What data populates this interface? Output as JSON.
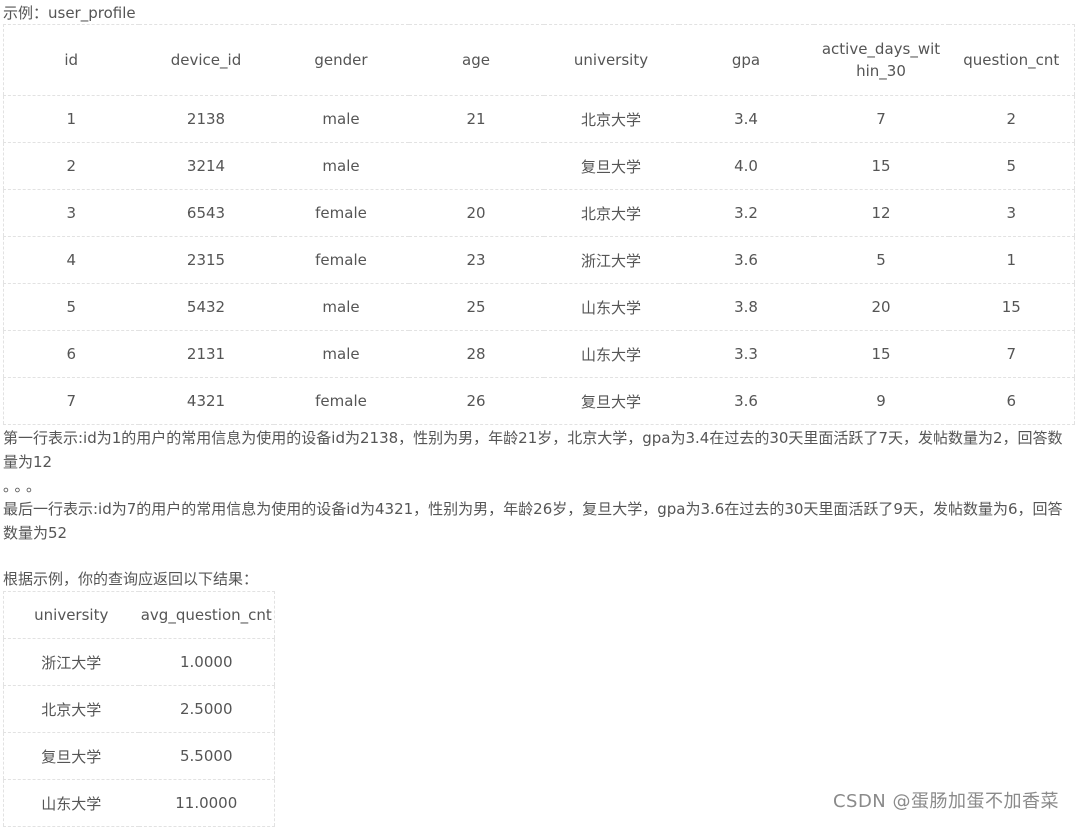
{
  "caption": "示例：user_profile",
  "table1": {
    "headers": [
      "id",
      "device_id",
      "gender",
      "age",
      "university",
      "gpa",
      "active_days_within_30",
      "question_cnt"
    ],
    "rows": [
      [
        "1",
        "2138",
        "male",
        "21",
        "北京大学",
        "3.4",
        "7",
        "2"
      ],
      [
        "2",
        "3214",
        "male",
        "",
        "复旦大学",
        "4.0",
        "15",
        "5"
      ],
      [
        "3",
        "6543",
        "female",
        "20",
        "北京大学",
        "3.2",
        "12",
        "3"
      ],
      [
        "4",
        "2315",
        "female",
        "23",
        "浙江大学",
        "3.6",
        "5",
        "1"
      ],
      [
        "5",
        "5432",
        "male",
        "25",
        "山东大学",
        "3.8",
        "20",
        "15"
      ],
      [
        "6",
        "2131",
        "male",
        "28",
        "山东大学",
        "3.3",
        "15",
        "7"
      ],
      [
        "7",
        "4321",
        "female",
        "26",
        "复旦大学",
        "3.6",
        "9",
        "6"
      ]
    ]
  },
  "para1": "第一行表示:id为1的用户的常用信息为使用的设备id为2138，性别为男，年龄21岁，北京大学，gpa为3.4在过去的30天里面活跃了7天，发帖数量为2，回答数量为12",
  "ellipsis": "。。。",
  "para2": "最后一行表示:id为7的用户的常用信息为使用的设备id为4321，性别为男，年龄26岁，复旦大学，gpa为3.6在过去的30天里面活跃了9天，发帖数量为6，回答数量为52",
  "result_intro": "根据示例，你的查询应返回以下结果：",
  "table2": {
    "headers": [
      "university",
      "avg_question_cnt"
    ],
    "rows": [
      [
        "浙江大学",
        "1.0000"
      ],
      [
        "北京大学",
        "2.5000"
      ],
      [
        "复旦大学",
        "5.5000"
      ],
      [
        "山东大学",
        "11.0000"
      ]
    ]
  },
  "watermark": "CSDN @蛋肠加蛋不加香菜"
}
